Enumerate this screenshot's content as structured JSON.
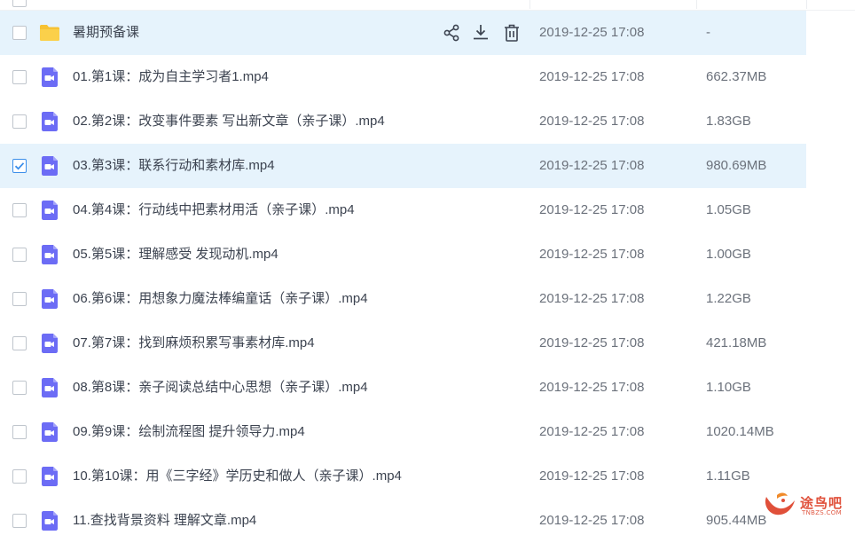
{
  "colors": {
    "folder": "#f7c233",
    "video_icon": "#6c6cf5",
    "highlight_row": "#e6f3fc",
    "checkbox_checked": "#3b8eea",
    "watermark": "#e0503a"
  },
  "rows": [
    {
      "type": "folder",
      "name": "暑期预备课",
      "date": "2019-12-25 17:08",
      "size": "-",
      "checked": false,
      "hover": true
    },
    {
      "type": "video",
      "name": "01.第1课：成为自主学习者1.mp4",
      "date": "2019-12-25 17:08",
      "size": "662.37MB",
      "checked": false
    },
    {
      "type": "video",
      "name": "02.第2课：改变事件要素 写出新文章（亲子课）.mp4",
      "date": "2019-12-25 17:08",
      "size": "1.83GB",
      "checked": false
    },
    {
      "type": "video",
      "name": "03.第3课：联系行动和素材库.mp4",
      "date": "2019-12-25 17:08",
      "size": "980.69MB",
      "checked": true
    },
    {
      "type": "video",
      "name": "04.第4课：行动线中把素材用活（亲子课）.mp4",
      "date": "2019-12-25 17:08",
      "size": "1.05GB",
      "checked": false
    },
    {
      "type": "video",
      "name": "05.第5课：理解感受 发现动机.mp4",
      "date": "2019-12-25 17:08",
      "size": "1.00GB",
      "checked": false
    },
    {
      "type": "video",
      "name": "06.第6课：用想象力魔法棒编童话（亲子课）.mp4",
      "date": "2019-12-25 17:08",
      "size": "1.22GB",
      "checked": false
    },
    {
      "type": "video",
      "name": "07.第7课：找到麻烦积累写事素材库.mp4",
      "date": "2019-12-25 17:08",
      "size": "421.18MB",
      "checked": false
    },
    {
      "type": "video",
      "name": "08.第8课：亲子阅读总结中心思想（亲子课）.mp4",
      "date": "2019-12-25 17:08",
      "size": "1.10GB",
      "checked": false
    },
    {
      "type": "video",
      "name": "09.第9课：绘制流程图 提升领导力.mp4",
      "date": "2019-12-25 17:08",
      "size": "1020.14MB",
      "checked": false
    },
    {
      "type": "video",
      "name": "10.第10课：用《三字经》学历史和做人（亲子课）.mp4",
      "date": "2019-12-25 17:08",
      "size": "1.11GB",
      "checked": false
    },
    {
      "type": "video",
      "name": "11.查找背景资料 理解文章.mp4",
      "date": "2019-12-25 17:08",
      "size": "905.44MB",
      "checked": false
    }
  ],
  "row_actions": [
    "share-icon",
    "download-icon",
    "delete-icon"
  ],
  "watermark": {
    "text": "途鸟吧",
    "sub": "TNBZS.COM"
  }
}
